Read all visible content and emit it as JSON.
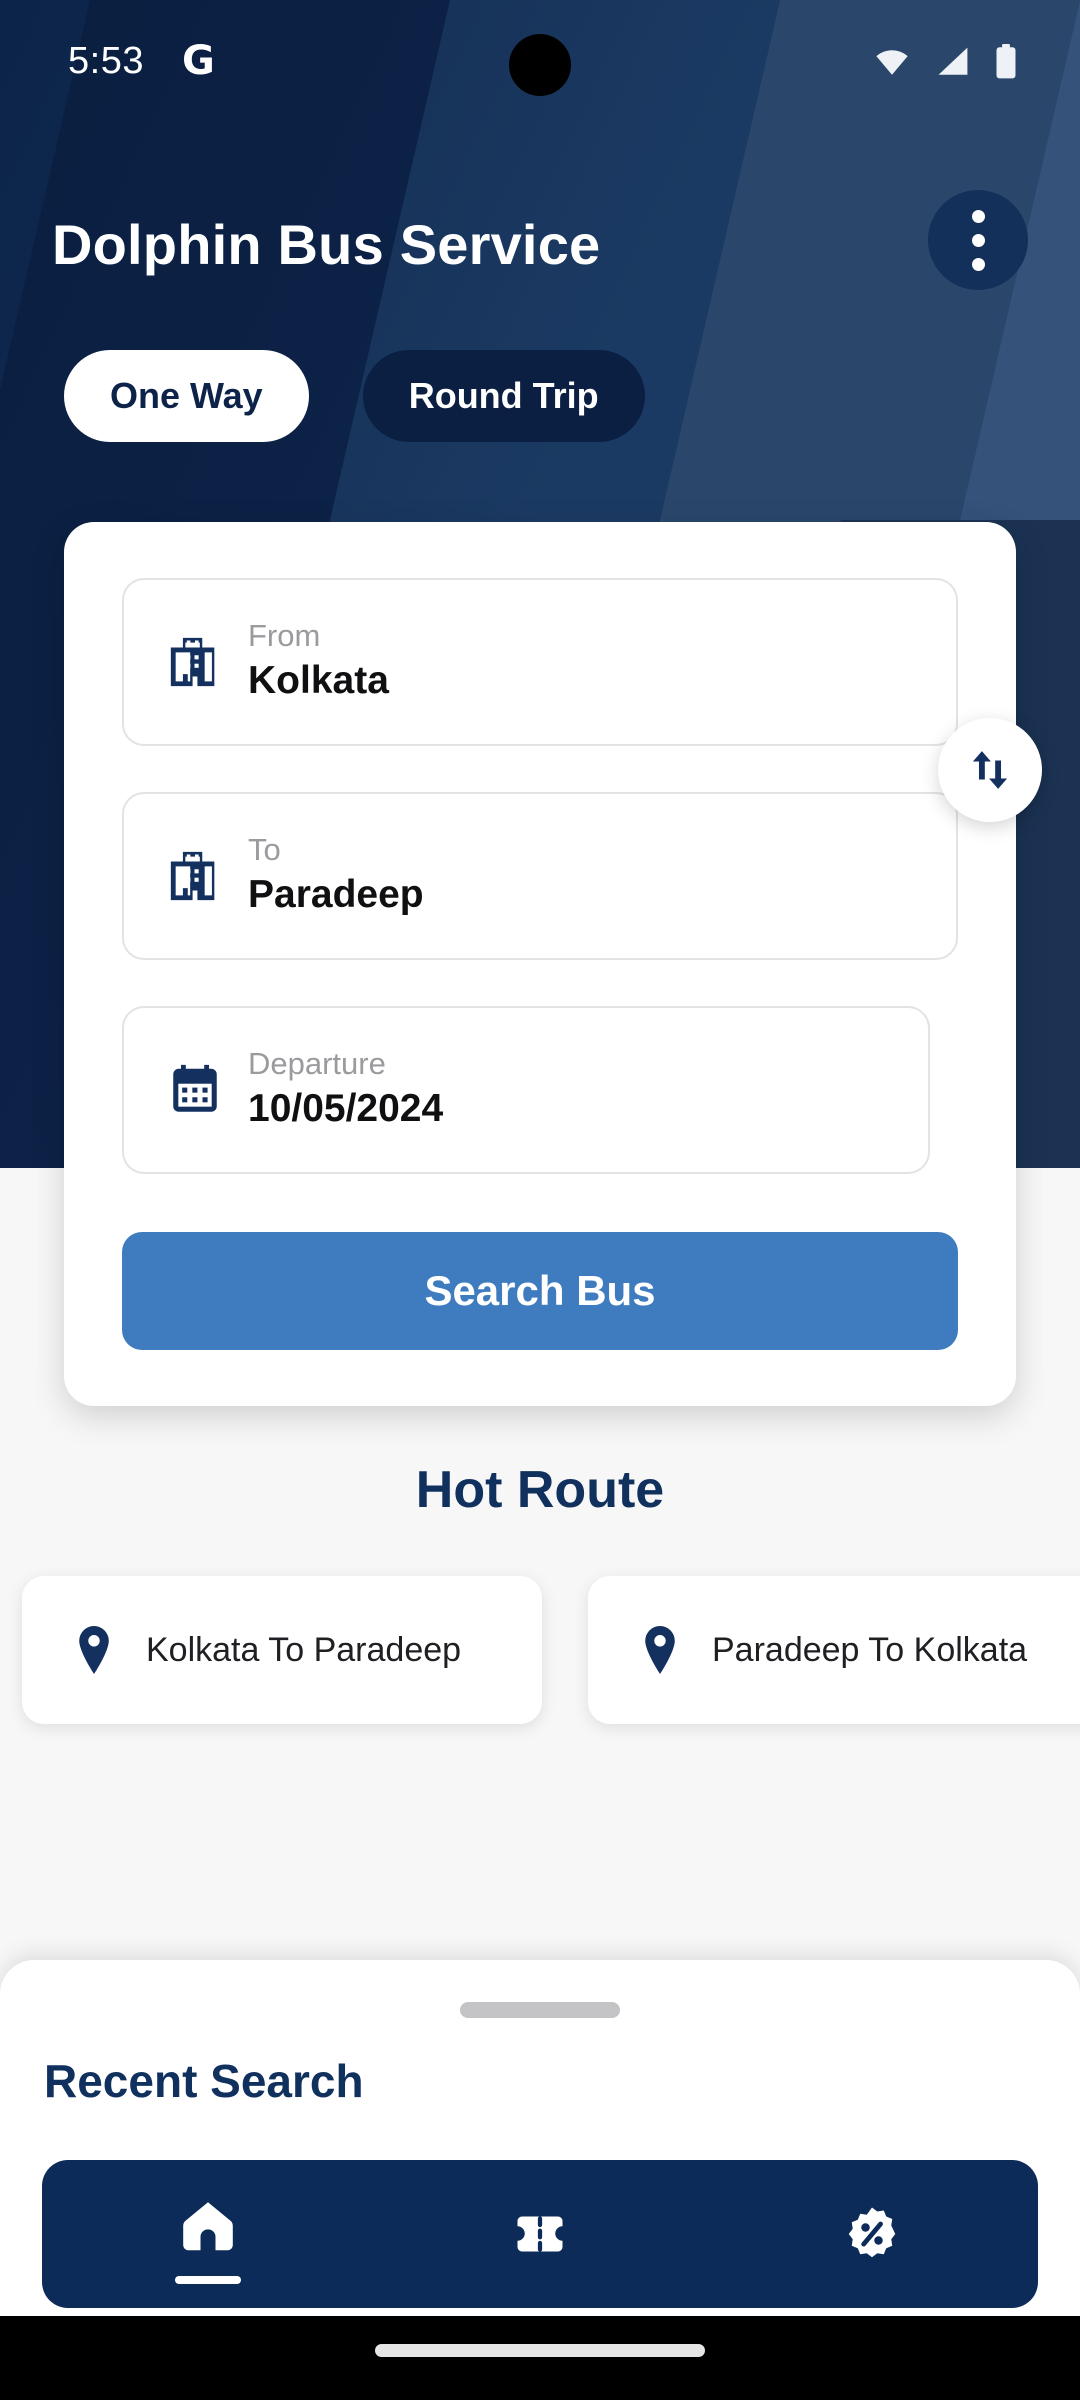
{
  "status_bar": {
    "time": "5:53",
    "app_indicator": "G",
    "icons": [
      "wifi-icon",
      "cellular-signal-icon",
      "battery-icon"
    ]
  },
  "header": {
    "title": "Dolphin Bus Service",
    "overflow_menu": "more-options",
    "tabs": [
      {
        "label": "One Way",
        "selected": true
      },
      {
        "label": "Round Trip",
        "selected": false
      }
    ]
  },
  "search_form": {
    "from": {
      "label": "From",
      "value": "Kolkata",
      "icon": "city-building-icon"
    },
    "to": {
      "label": "To",
      "value": "Paradeep",
      "icon": "city-building-icon"
    },
    "departure": {
      "label": "Departure",
      "value": "10/05/2024",
      "icon": "calendar-icon"
    },
    "swap_button": "swap-vertical-icon",
    "submit_label": "Search Bus"
  },
  "hot_route": {
    "title": "Hot Route",
    "items": [
      {
        "label": "Kolkata To Paradeep",
        "icon": "location-pin-icon"
      },
      {
        "label": "Paradeep To Kolkata",
        "icon": "location-pin-icon"
      }
    ]
  },
  "recent_search": {
    "title": "Recent Search"
  },
  "bottom_nav": {
    "items": [
      {
        "name": "home",
        "icon": "home-icon",
        "active": true
      },
      {
        "name": "tickets",
        "icon": "ticket-icon",
        "active": false
      },
      {
        "name": "offers",
        "icon": "discount-badge-icon",
        "active": false
      }
    ]
  },
  "colors": {
    "header_navy": "#12305c",
    "deep_navy": "#0d2349",
    "accent_blue": "#3f7cbf",
    "nav_bar": "#0d2b58",
    "page_bg": "#f7f7f8",
    "label_grey": "#9b9b9f"
  }
}
